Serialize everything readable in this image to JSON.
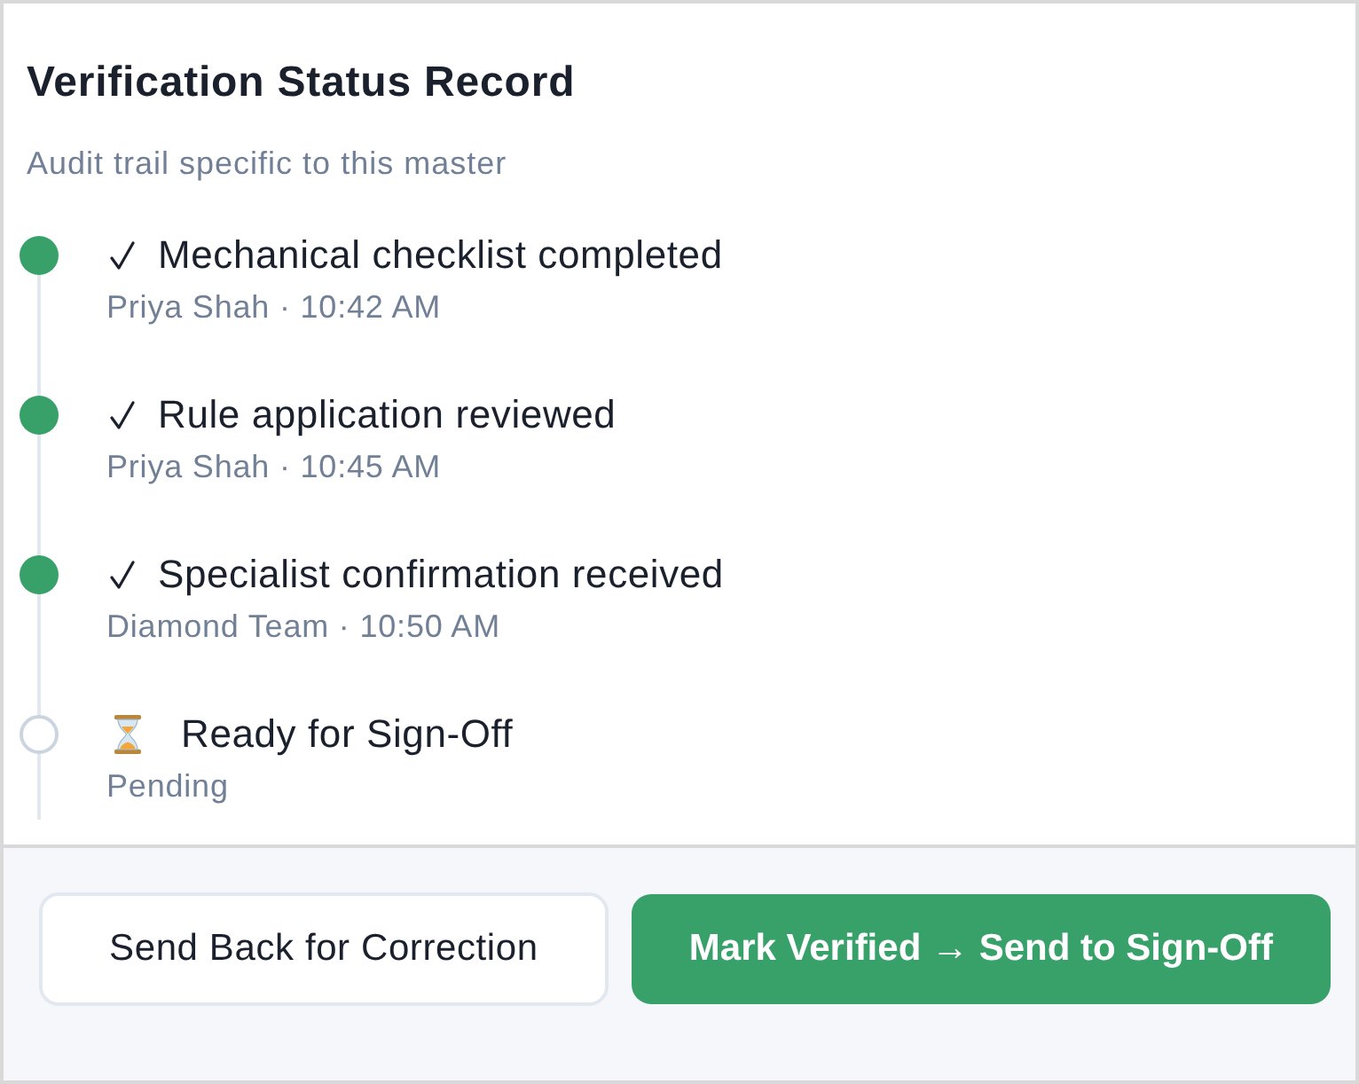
{
  "panel": {
    "title": "Verification Status Record",
    "subtitle": "Audit trail specific to this master"
  },
  "steps": [
    {
      "title": "Mechanical checklist completed",
      "meta": "Priya Shah · 10:42 AM",
      "completed": true
    },
    {
      "title": "Rule application reviewed",
      "meta": "Priya Shah · 10:45 AM",
      "completed": true
    },
    {
      "title": "Specialist confirmation received",
      "meta": "Diamond Team · 10:50 AM",
      "completed": true
    },
    {
      "title": "Ready for Sign-Off",
      "meta": "Pending",
      "completed": false
    }
  ],
  "actions": [
    {
      "label": "Send Back for Correction",
      "kind": "secondary"
    },
    {
      "label": "Mark Verified → Send to Sign-Off",
      "kind": "primary"
    }
  ]
}
